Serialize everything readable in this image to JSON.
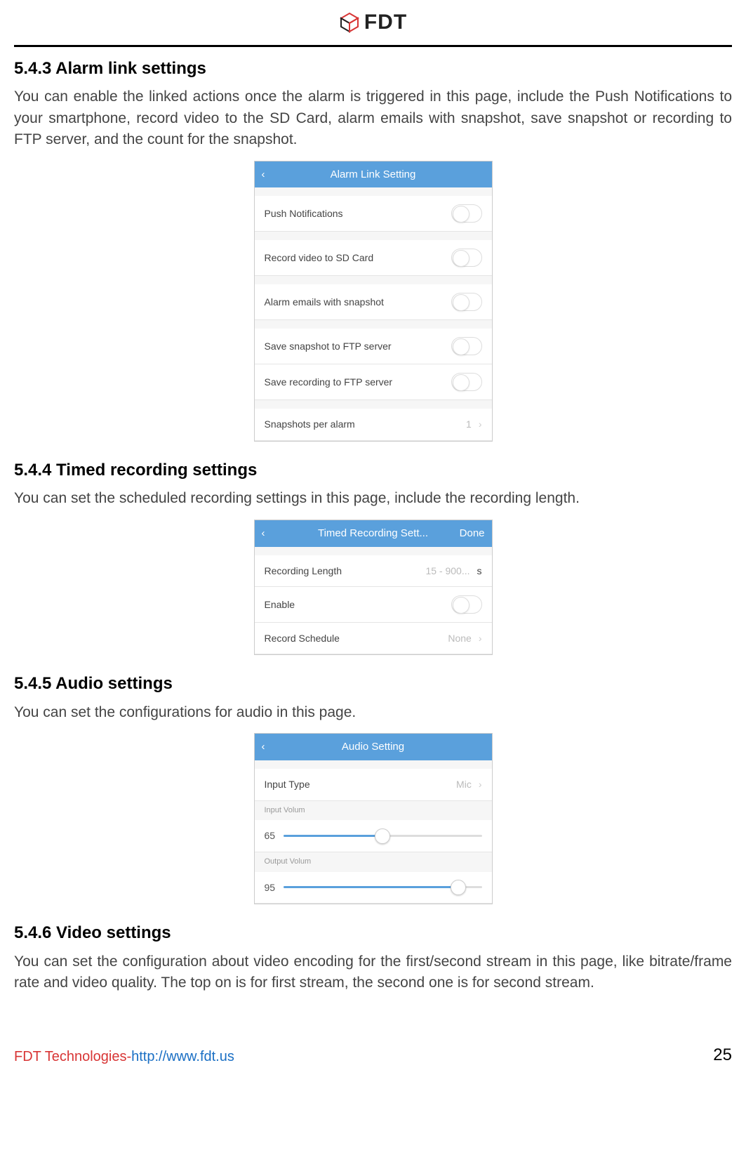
{
  "brand": "FDT",
  "sections": {
    "s543": {
      "heading": "5.4.3 Alarm link settings",
      "body": "You can enable the linked actions once the alarm is triggered in this page, include the Push Notifications to your smartphone, record video to the SD Card, alarm emails with snapshot, save snapshot or recording to FTP server, and the count for the snapshot.",
      "screen": {
        "title": "Alarm Link Setting",
        "rows": {
          "push": "Push Notifications",
          "record_sd": "Record video to SD Card",
          "alarm_email": "Alarm emails with snapshot",
          "save_snap_ftp": "Save snapshot to FTP server",
          "save_rec_ftp": "Save recording to FTP server",
          "snap_per_alarm_label": "Snapshots per alarm",
          "snap_per_alarm_value": "1"
        }
      }
    },
    "s544": {
      "heading": "5.4.4 Timed recording settings",
      "body": "You can set the scheduled recording settings in this page, include the recording length.",
      "screen": {
        "title": "Timed Recording Sett...",
        "done": "Done",
        "rows": {
          "rec_len_label": "Recording Length",
          "rec_len_placeholder": "15 - 900...",
          "rec_len_unit": "s",
          "enable": "Enable",
          "record_schedule_label": "Record Schedule",
          "record_schedule_value": "None"
        }
      }
    },
    "s545": {
      "heading": "5.4.5 Audio settings",
      "body": "You can set the configurations for audio in this page.",
      "screen": {
        "title": "Audio Setting",
        "rows": {
          "input_type_label": "Input Type",
          "input_type_value": "Mic",
          "input_volum_label": "Input Volum",
          "input_volum_value": "65",
          "output_volum_label": "Output Volum",
          "output_volum_value": "95"
        }
      }
    },
    "s546": {
      "heading": "5.4.6 Video settings",
      "body": "You can set the configuration about video encoding for the first/second stream in this page, like bitrate/frame rate and video quality. The top on is for first stream, the second one is for second stream."
    }
  },
  "footer": {
    "company": "FDT Technologies-",
    "url": "http://www.fdt.us",
    "page": "25"
  }
}
